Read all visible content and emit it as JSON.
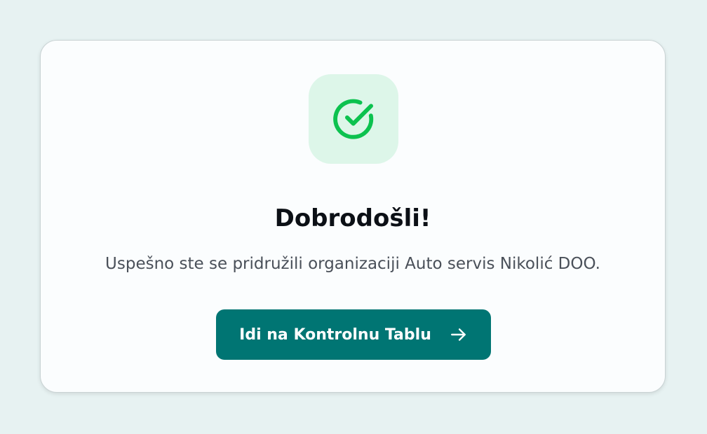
{
  "welcome_card": {
    "icon": "check-circle-icon",
    "title": "Dobrodošli!",
    "message": "Uspešno ste se pridružili organizaciji Auto servis Nikolić DOO.",
    "cta_label": "Idi na Kontrolnu Tablu",
    "cta_icon": "arrow-right-icon"
  },
  "colors": {
    "page_background": "#e7f2f2",
    "card_background": "#fbfdfe",
    "icon_tile_background": "#ddf6e9",
    "success_green": "#0cc24f",
    "primary_button": "#007573",
    "title_text": "#0c1016",
    "body_text": "#4a5059"
  }
}
